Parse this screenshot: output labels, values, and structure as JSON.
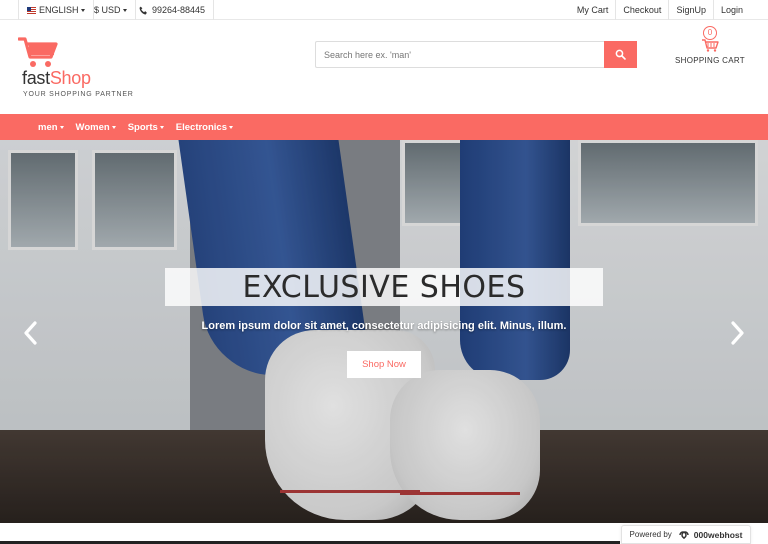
{
  "topbar": {
    "language": "ENGLISH",
    "currency": "$ USD",
    "phone": "99264-88445",
    "links": [
      "My Cart",
      "Checkout",
      "SignUp",
      "Login"
    ]
  },
  "header": {
    "logo_part1": "fast",
    "logo_part2": "Shop",
    "tagline": "YOUR SHOPPING PARTNER",
    "search_placeholder": "Search here ex. 'man'",
    "cart_count": "0",
    "cart_label": "SHOPPING CART"
  },
  "nav": {
    "items": [
      "men",
      "Women",
      "Sports",
      "Electronics"
    ]
  },
  "hero": {
    "title": "EXCLUSIVE SHOES",
    "subtitle": "Lorem ipsum dolor sit amet, consectetur adipisicing elit. Minus, illum.",
    "button": "Shop Now"
  },
  "footer_badge": {
    "powered_by": "Powered by",
    "host": "000webhost"
  },
  "colors": {
    "accent": "#fa6a63",
    "text": "#333333"
  },
  "icons": {
    "flag": "uk-flag-icon",
    "phone": "phone-icon",
    "search": "search-icon",
    "cart": "cart-icon",
    "prev": "chevron-left-icon",
    "next": "chevron-right-icon"
  }
}
